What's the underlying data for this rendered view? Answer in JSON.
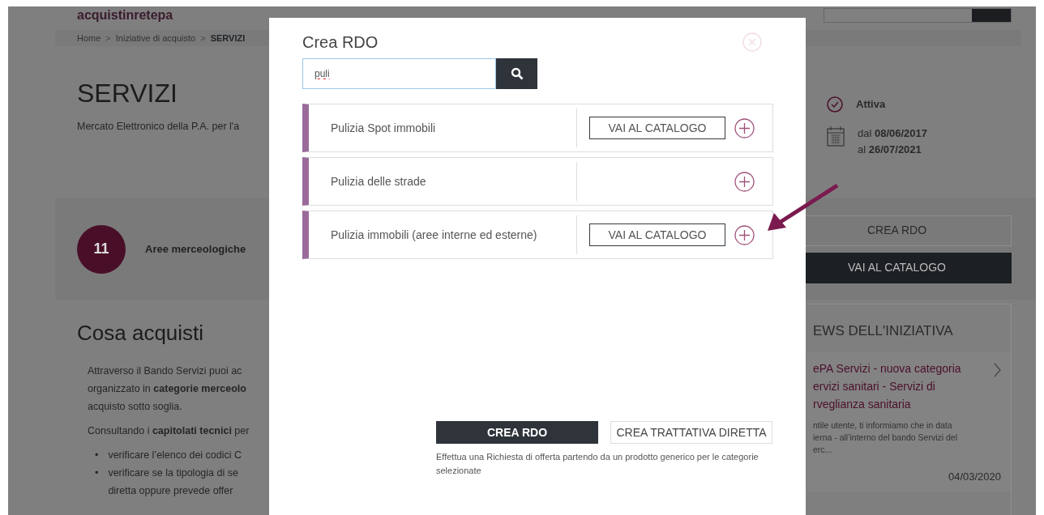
{
  "header": {
    "logo": "acquistinretepa"
  },
  "breadcrumb": {
    "separator": ">",
    "items": [
      {
        "label": "Home",
        "current": false
      },
      {
        "label": "Iniziative di acquisto",
        "current": false
      },
      {
        "label": "SERVIZI",
        "current": true
      }
    ]
  },
  "page": {
    "title": "SERVIZI",
    "subtitle": "Mercato Elettronico della P.A. per l'a",
    "status": "Attiva",
    "date_from": "dal **08/06/2017**",
    "date_to": "al **26/07/2021**"
  },
  "areas": {
    "count": "11",
    "label": "Aree merceologiche"
  },
  "actions": [
    {
      "label": "CREA RDO",
      "kind": "outline"
    },
    {
      "label": "VAI AL CATALOGO",
      "kind": "dark"
    }
  ],
  "content": {
    "heading": "Cosa acquisti",
    "paragraphs": [
      [
        "Attraverso il Bando Servizi puoi ac",
        "organizzato in **categorie merceolo**",
        "acquisto sotto soglia."
      ],
      [
        "Consultando i **capitolati tecnici** per"
      ]
    ],
    "bullet_marker": "•",
    "bullets": [
      [
        "verificare l’elenco dei codici C"
      ],
      [
        "verificare se la tipologia di se",
        "diretta oppure prevede offer"
      ]
    ]
  },
  "news": {
    "heading": "EWS DELL'INIZIATIVA",
    "items": [
      {
        "title_lines": [
          "ePA Servizi - nuova categoria",
          "ervizi sanitari - Servizi di",
          "rveglianza sanitaria"
        ],
        "snippet_lines": [
          "ntile utente, ti informiamo che in data",
          "ierna - all’interno del bando Servizi del",
          "erc..."
        ],
        "date": "04/03/2020"
      }
    ]
  },
  "modal": {
    "title": "Crea RDO",
    "search": {
      "value": "puli"
    },
    "results": [
      {
        "name": "Pulizia Spot immobili",
        "catalog_button": "VAI AL CATALOGO"
      },
      {
        "name": "Pulizia delle strade"
      },
      {
        "name": "Pulizia immobili (aree interne ed esterne)",
        "catalog_button": "VAI AL CATALOGO"
      }
    ],
    "buttons": [
      {
        "label": "CREA RDO",
        "kind": "dark"
      },
      {
        "label": "CREA TRATTATIVA DIRETTA",
        "kind": "outline"
      }
    ],
    "note": "Effettua una Richiesta di offerta partendo da un prodotto generico per le categorie selezionate"
  }
}
